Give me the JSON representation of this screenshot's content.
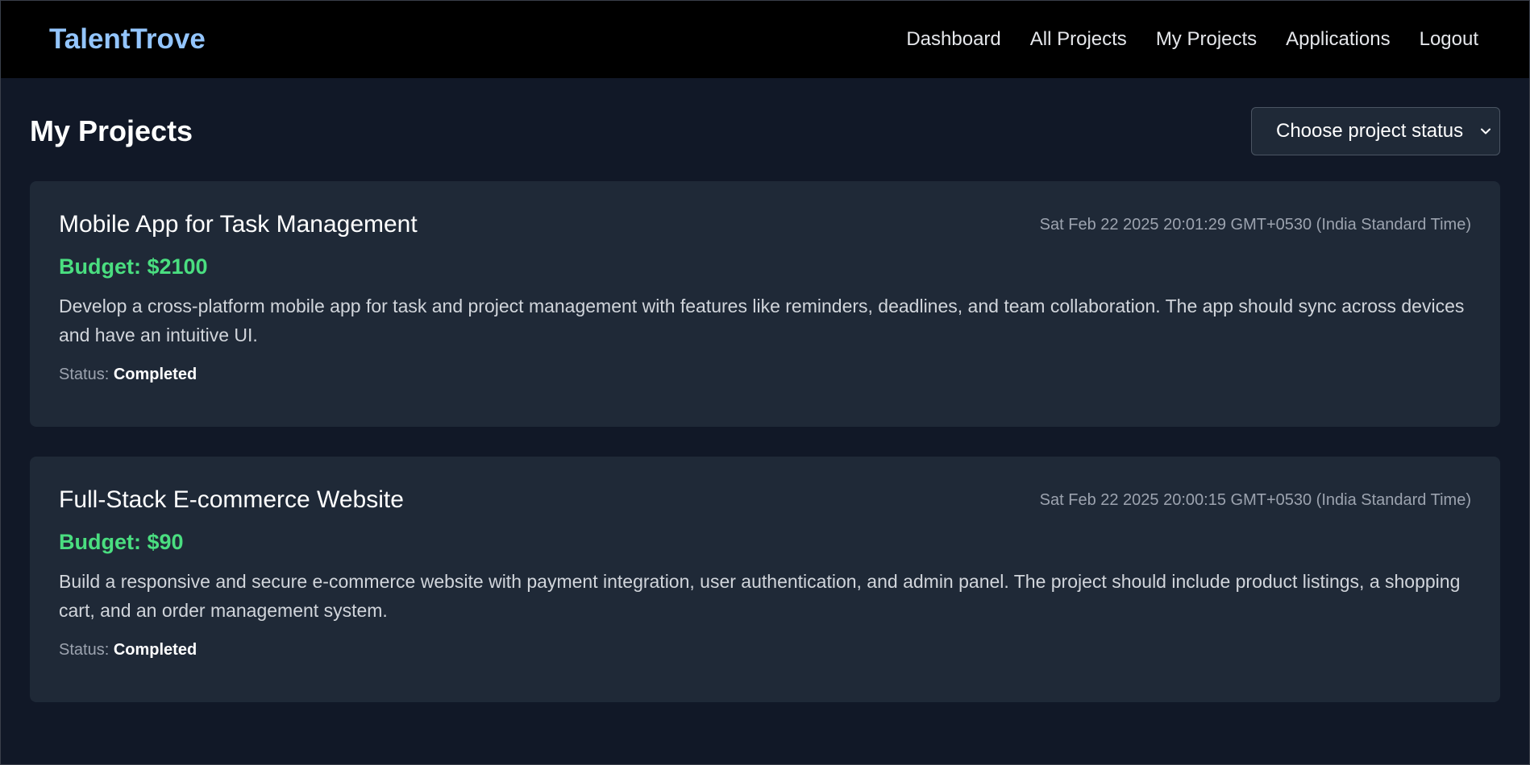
{
  "navbar": {
    "brand": "TalentTrove",
    "links": [
      {
        "label": "Dashboard"
      },
      {
        "label": "All Projects"
      },
      {
        "label": "My Projects"
      },
      {
        "label": "Applications"
      },
      {
        "label": "Logout"
      }
    ]
  },
  "main": {
    "title": "My Projects",
    "status_filter": {
      "selected": "Choose project status",
      "icon": "chevron-down-icon"
    },
    "projects": [
      {
        "title": "Mobile App for Task Management",
        "date": "Sat Feb 22 2025 20:01:29 GMT+0530 (India Standard Time)",
        "budget": "Budget: $2100",
        "description": "Develop a cross-platform mobile app for task and project management with features like reminders, deadlines, and team collaboration. The app should sync across devices and have an intuitive UI.",
        "status_label": "Status:",
        "status_value": "Completed"
      },
      {
        "title": "Full-Stack E-commerce Website",
        "date": "Sat Feb 22 2025 20:00:15 GMT+0530 (India Standard Time)",
        "budget": "Budget: $90",
        "description": "Build a responsive and secure e-commerce website with payment integration, user authentication, and admin panel. The project should include product listings, a shopping cart, and an order management system.",
        "status_label": "Status:",
        "status_value": "Completed"
      }
    ]
  },
  "colors": {
    "background": "#111827",
    "navbar": "#000000",
    "card": "#1f2937",
    "brand": "#93c5fd",
    "budget": "#4ade80",
    "muted": "#9ca3af"
  }
}
